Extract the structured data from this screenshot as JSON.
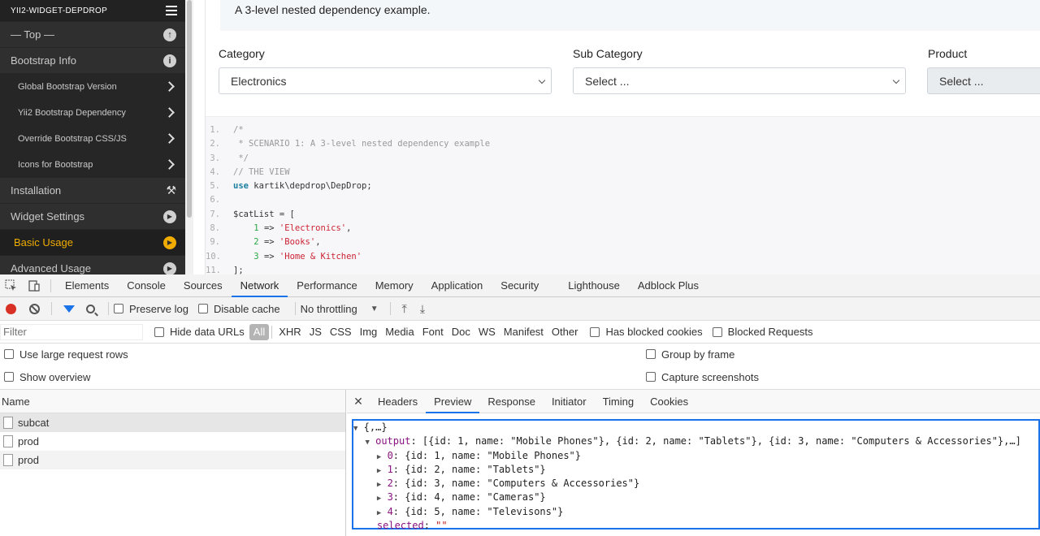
{
  "sidebar": {
    "title": "Yii2-widget-depdrop",
    "items": [
      {
        "label": "— Top —",
        "icon": "arrow-up-circle-icon",
        "glyph": "↑"
      },
      {
        "label": "Bootstrap Info",
        "icon": "info-circle-icon",
        "glyph": "i"
      },
      {
        "label": "Global Bootstrap Version",
        "icon": "chevron-right-icon"
      },
      {
        "label": "Yii2 Bootstrap Dependency",
        "icon": "chevron-right-icon"
      },
      {
        "label": "Override Bootstrap CSS/JS",
        "icon": "chevron-right-icon"
      },
      {
        "label": "Icons for Bootstrap",
        "icon": "chevron-right-icon"
      },
      {
        "label": "Installation",
        "icon": "wrench-icon",
        "glyph": "🔧"
      },
      {
        "label": "Widget Settings",
        "icon": "play-circle-icon",
        "glyph": "▶"
      },
      {
        "label": "Basic Usage",
        "icon": "play-circle-icon",
        "glyph": "▶"
      },
      {
        "label": "Advanced Usage",
        "icon": "play-circle-icon",
        "glyph": "▶"
      }
    ]
  },
  "content": {
    "alert_text": "A 3-level nested dependency example.",
    "fields": [
      {
        "label": "Category",
        "value": "Electronics"
      },
      {
        "label": "Sub Category",
        "value": "Select ..."
      },
      {
        "label": "Product",
        "value": "Select ..."
      }
    ],
    "code_lines": [
      "1.",
      "2.",
      "3.",
      "4.",
      "5.",
      "6.",
      "7.",
      "8.",
      "9.",
      "10.",
      "11."
    ],
    "code": {
      "l1": "/*",
      "l2": " * SCENARIO 1: A 3-level nested dependency example",
      "l3": " */",
      "l4": "// THE VIEW",
      "l5_kw": "use",
      "l5_rest": " kartik\\depdrop\\DepDrop;",
      "l7": "$catList = [",
      "l8_num": "1",
      "l8_str": "'Electronics'",
      "l9_num": "2",
      "l9_str": "'Books'",
      "l10_num": "3",
      "l10_str": "'Home & Kitchen'",
      "l11": "];",
      "arrow": " => "
    }
  },
  "devtools": {
    "tabs": [
      "Elements",
      "Console",
      "Sources",
      "Network",
      "Performance",
      "Memory",
      "Application",
      "Security",
      "Lighthouse",
      "Adblock Plus"
    ],
    "active_tab": "Network",
    "toolbar": {
      "preserve_log": "Preserve log",
      "disable_cache": "Disable cache",
      "throttling": "No throttling"
    },
    "filter": {
      "placeholder": "Filter",
      "hide_data_urls": "Hide data URLs",
      "types": [
        "All",
        "XHR",
        "JS",
        "CSS",
        "Img",
        "Media",
        "Font",
        "Doc",
        "WS",
        "Manifest",
        "Other"
      ],
      "blocked_cookies": "Has blocked cookies",
      "blocked_requests": "Blocked Requests"
    },
    "options": {
      "large_rows": "Use large request rows",
      "group_by_frame": "Group by frame",
      "show_overview": "Show overview",
      "capture_screenshots": "Capture screenshots"
    },
    "requests": {
      "header": "Name",
      "items": [
        "subcat",
        "prod",
        "prod"
      ]
    },
    "detail": {
      "tabs": [
        "Headers",
        "Preview",
        "Response",
        "Initiator",
        "Timing",
        "Cookies"
      ],
      "active_tab": "Preview",
      "preview": {
        "root": "{,…}",
        "output_key": "output",
        "output_summary": "[{id: 1, name: \"Mobile Phones\"}, {id: 2, name: \"Tablets\"}, {id: 3, name: \"Computers & Accessories\"},…]",
        "rows": [
          {
            "idx": "0",
            "text": "{id: 1, name: \"Mobile Phones\"}"
          },
          {
            "idx": "1",
            "text": "{id: 2, name: \"Tablets\"}"
          },
          {
            "idx": "2",
            "text": "{id: 3, name: \"Computers & Accessories\"}"
          },
          {
            "idx": "3",
            "text": "{id: 4, name: \"Cameras\"}"
          },
          {
            "idx": "4",
            "text": "{id: 5, name: \"Televisons\"}"
          }
        ],
        "selected_key": "selected",
        "selected_value": "\"\""
      }
    }
  }
}
